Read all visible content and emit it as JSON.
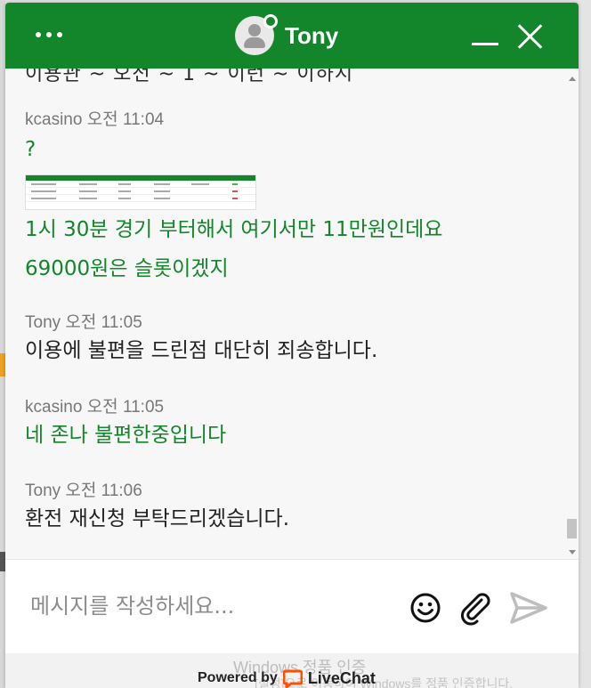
{
  "header": {
    "agent_name": "Tony"
  },
  "chat": {
    "cut_text": "이용관 ~ 오전 ~ 1 ~ 이런 ~ 이하시",
    "messages": [
      {
        "author": "kcasino",
        "time": "오전 11:04",
        "role": "visitor",
        "lines": [
          "?",
          "1시 30분 경기 부터해서 여기서만 11만원인데요",
          "69000원은 슬롯이겠지"
        ],
        "has_image": true
      },
      {
        "author": "Tony",
        "time": "오전 11:05",
        "role": "agent",
        "lines": [
          "이용에 불편을 드린점 대단히 죄송합니다."
        ]
      },
      {
        "author": "kcasino",
        "time": "오전 11:05",
        "role": "visitor",
        "lines": [
          "네 존나 불편한중입니다"
        ]
      },
      {
        "author": "Tony",
        "time": "오전 11:06",
        "role": "agent",
        "lines": [
          "환전 재신청 부탁드리겠습니다."
        ]
      }
    ]
  },
  "composer": {
    "placeholder": "메시지를 작성하세요..."
  },
  "footer": {
    "powered_label": "Powered by",
    "brand": "LiveChat",
    "watermark_title": "Windows 정품 인증",
    "watermark_sub": "[설정]으로 이동하여 Windows를 정품 인증합니다."
  },
  "colors": {
    "brand_green": "#13852b",
    "livechat_orange": "#ff5100"
  },
  "icons": [
    "menu-dots-icon",
    "avatar-icon",
    "minimize-icon",
    "close-icon",
    "emoji-icon",
    "attach-icon",
    "send-icon",
    "livechat-logo-icon"
  ]
}
